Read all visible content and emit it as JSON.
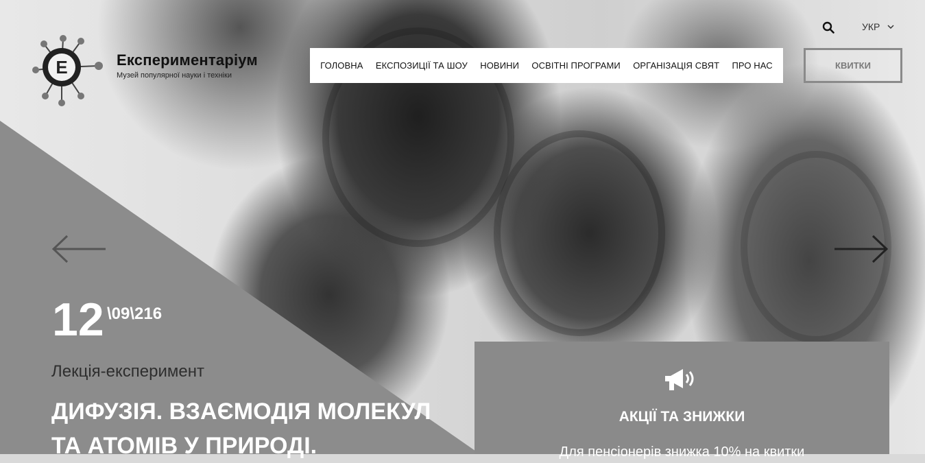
{
  "brand": {
    "name": "Експериментаріум",
    "tagline": "Музей популярної науки і техніки",
    "logo_letter": "E"
  },
  "nav": {
    "items": [
      {
        "label": "Головна"
      },
      {
        "label": "Експозиції та шоу"
      },
      {
        "label": "Новини"
      },
      {
        "label": "Освітні програми"
      },
      {
        "label": "Організація свят"
      },
      {
        "label": "Про нас"
      }
    ]
  },
  "header": {
    "tickets_label": "КВИТКИ",
    "language": "УКР",
    "icons": {
      "search": "search-icon",
      "language_dropdown": "chevron-down-icon"
    }
  },
  "slider": {
    "prev_icon": "arrow-left-icon",
    "next_icon": "arrow-right-icon"
  },
  "event": {
    "day": "12",
    "month_year": "\\09\\216",
    "type": "Лекція-експеримент",
    "title_line1": "Дифузія. Взаємодія молекул",
    "title_line2": "та атомів у природі."
  },
  "promo": {
    "icon": "megaphone-icon",
    "title": "Акції та знижки",
    "text": "Для пенсіонерів знижка 10% на квитки"
  },
  "colors": {
    "nav_bg": "#ffffff",
    "triangle": "#8c8c8c",
    "promo_bg": "#8a8a8a",
    "text_dark": "#111111"
  }
}
